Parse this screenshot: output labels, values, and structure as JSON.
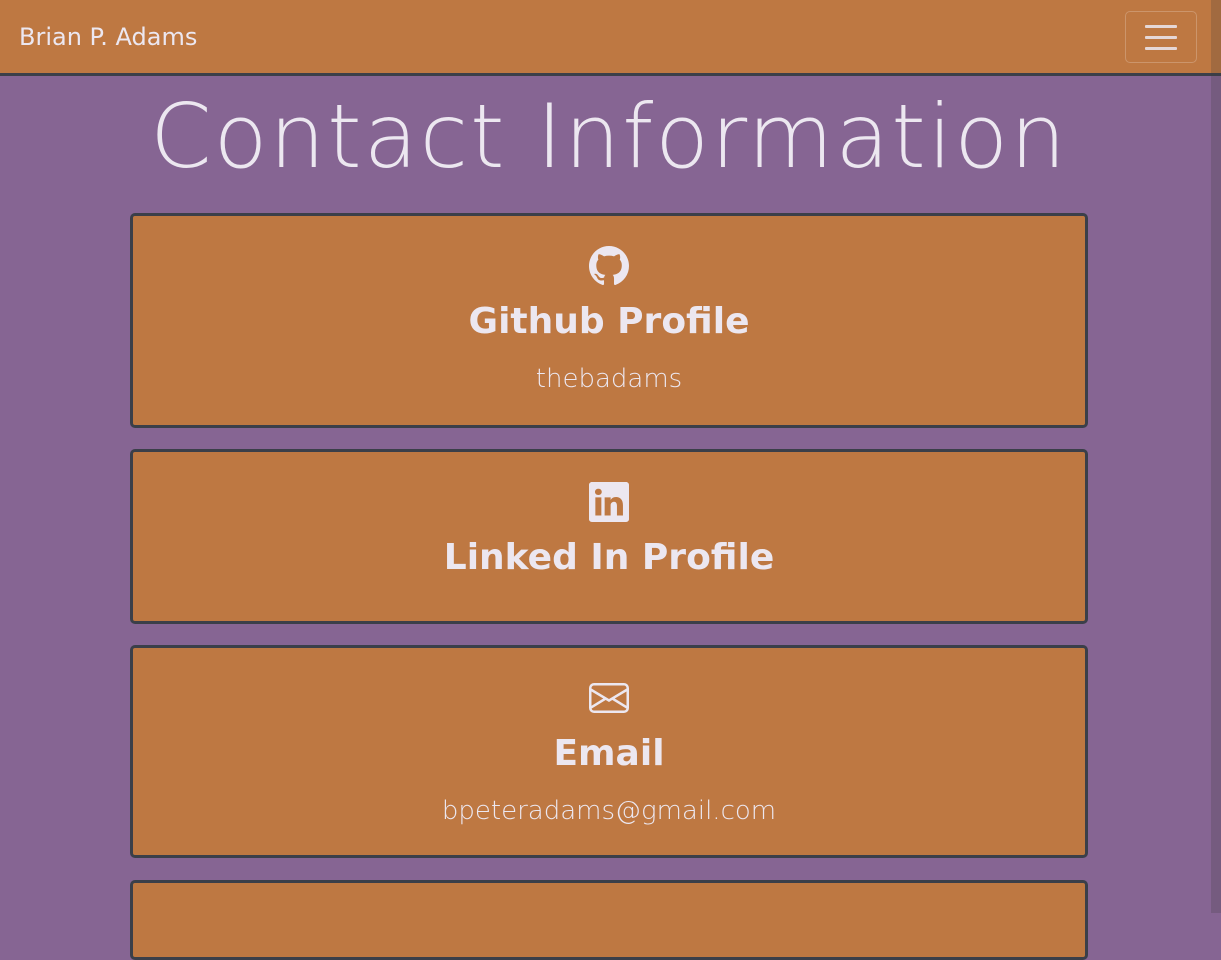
{
  "navbar": {
    "brand": "Brian P. Adams",
    "toggler_icon": "hamburger-menu-icon"
  },
  "page": {
    "title": "Contact Information"
  },
  "cards": [
    {
      "icon": "github-icon",
      "title": "Github Profile",
      "text": "thebadams"
    },
    {
      "icon": "linkedin-icon",
      "title": "Linked In Profile",
      "text": ""
    },
    {
      "icon": "envelope-icon",
      "title": "Email",
      "text": "bpeteradams@gmail.com"
    }
  ],
  "colors": {
    "background": "#866593",
    "surface": "#be7842",
    "border": "#3b3f49",
    "text": "#ece7f0"
  }
}
